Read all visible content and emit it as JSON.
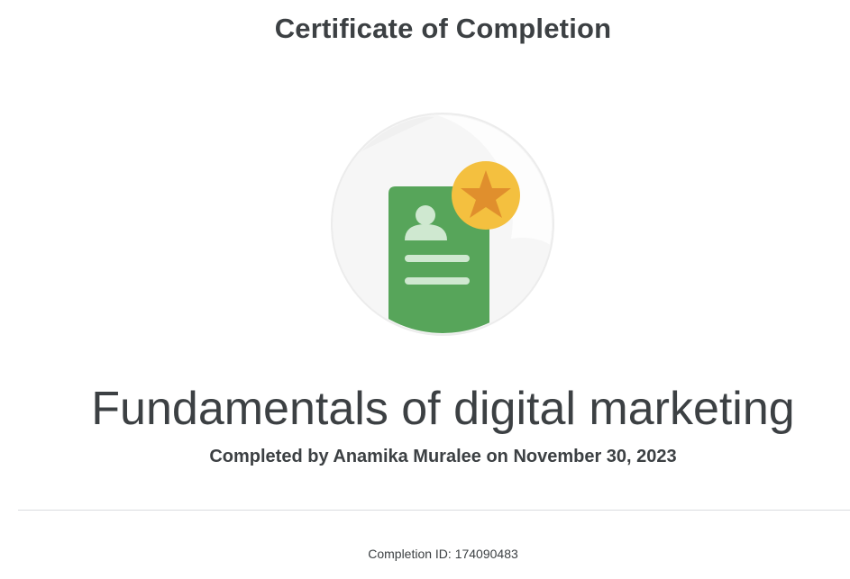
{
  "certificate": {
    "heading": "Certificate of Completion",
    "course_title": "Fundamentals of digital marketing",
    "completed_line": "Completed by Anamika Muralee on November 30, 2023",
    "completion_id": "Completion ID: 174090483"
  },
  "badge": {
    "icon": "certificate-badge-icon",
    "card_color": "#57a55a",
    "star_circle_color": "#f4c03f",
    "star_color": "#e08f2d",
    "circle_bg": "#f1f1f1"
  }
}
